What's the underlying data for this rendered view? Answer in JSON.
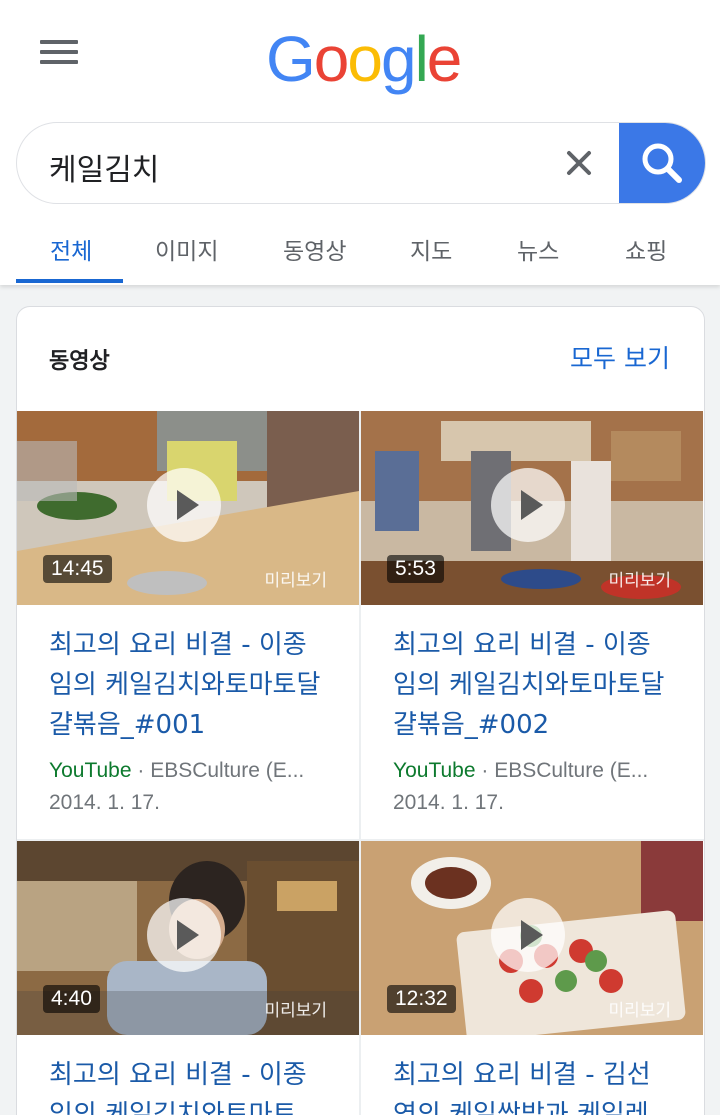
{
  "header": {
    "logo_text": "Google",
    "logo_colors": [
      "#4285f4",
      "#ea4335",
      "#fbbc05",
      "#4285f4",
      "#34a853",
      "#ea4335"
    ]
  },
  "search": {
    "query": "케일김치",
    "accent": "#3b78e7"
  },
  "tabs": [
    {
      "label": "전체",
      "active": true
    },
    {
      "label": "이미지",
      "active": false
    },
    {
      "label": "동영상",
      "active": false
    },
    {
      "label": "지도",
      "active": false
    },
    {
      "label": "뉴스",
      "active": false
    },
    {
      "label": "쇼핑",
      "active": false
    }
  ],
  "videos_section": {
    "title": "동영상",
    "see_all": "모두 보기",
    "items": [
      {
        "duration": "14:45",
        "preview_label": "미리보기",
        "title": "최고의 요리 비결 - 이종임의 케일김치와토마토달걀볶음_#001",
        "source": "YouTube",
        "channel": " · EBSCulture (E...",
        "date": "2014. 1. 17."
      },
      {
        "duration": "5:53",
        "preview_label": "미리보기",
        "title": "최고의 요리 비결 - 이종임의 케일김치와토마토달걀볶음_#002",
        "source": "YouTube",
        "channel": " · EBSCulture (E...",
        "date": "2014. 1. 17."
      },
      {
        "duration": "4:40",
        "preview_label": "미리보기",
        "title": "최고의 요리 비결 - 이종임의 케일김치와토마토",
        "source": "",
        "channel": "",
        "date": ""
      },
      {
        "duration": "12:32",
        "preview_label": "미리보기",
        "title": "최고의 요리 비결 - 김선영의 케일쌈밥과 케일레",
        "source": "",
        "channel": "",
        "date": ""
      }
    ]
  }
}
